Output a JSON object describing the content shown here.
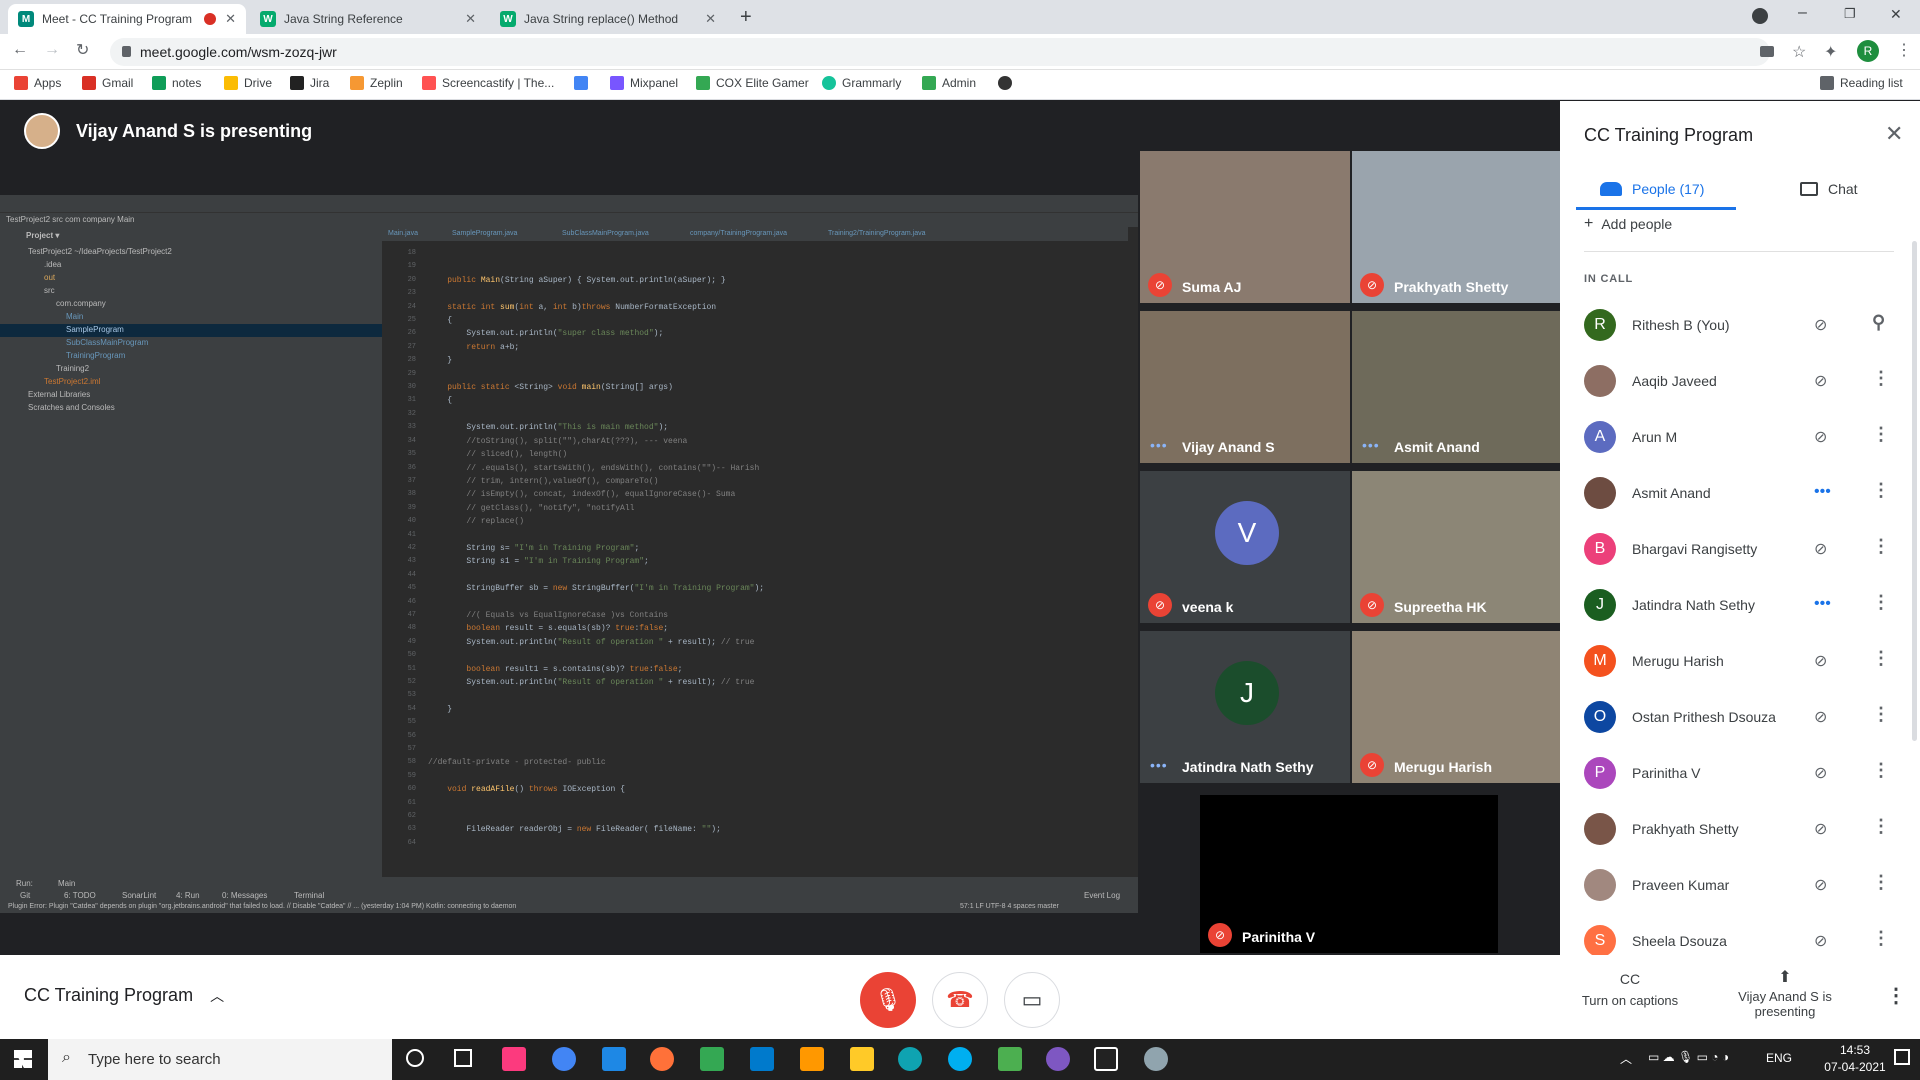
{
  "browser": {
    "tabs": [
      {
        "title": "Meet - CC Training Program",
        "active": true
      },
      {
        "title": "Java String Reference",
        "active": false
      },
      {
        "title": "Java String replace() Method",
        "active": false
      }
    ],
    "url": "meet.google.com/wsm-zozq-jwr",
    "bookmarks": [
      "Apps",
      "Gmail",
      "notes",
      "Drive",
      "Jira",
      "Zeplin",
      "Screencastify | The...",
      "Mixpanel",
      "COX Elite Gamer",
      "Grammarly",
      "Admin"
    ],
    "reading_list": "Reading list",
    "profile_initial": "R"
  },
  "meet": {
    "presenting_text": "Vijay Anand S is presenting",
    "meeting_name": "CC Training Program",
    "tiles": [
      {
        "name": "Suma AJ",
        "muted": true
      },
      {
        "name": "Prakhyath Shetty",
        "muted": true
      },
      {
        "name": "Vijay Anand S",
        "muted": false
      },
      {
        "name": "Asmit Anand",
        "muted": false
      },
      {
        "name": "veena k",
        "muted": true,
        "initial": "V"
      },
      {
        "name": "Supreetha HK",
        "muted": true
      },
      {
        "name": "Jatindra Nath Sethy",
        "muted": false,
        "initial": "J"
      },
      {
        "name": "Merugu Harish",
        "muted": true
      },
      {
        "name": "Parinitha V",
        "muted": true
      }
    ],
    "controls": {
      "captions": "Turn on captions",
      "presenting": "Vijay Anand S is presenting"
    }
  },
  "panel": {
    "title": "CC Training Program",
    "tab_people": "People (17)",
    "tab_chat": "Chat",
    "add_people": "Add people",
    "section": "IN CALL",
    "people": [
      {
        "name": "Rithesh B (You)",
        "initial": "R",
        "color": "#33691e",
        "state": "muted"
      },
      {
        "name": "Aaqib Javeed",
        "initial": "",
        "color": "#8d6e63",
        "state": "muted"
      },
      {
        "name": "Arun M",
        "initial": "A",
        "color": "#5c6bc0",
        "state": "muted"
      },
      {
        "name": "Asmit Anand",
        "initial": "",
        "color": "#6d4c41",
        "state": "talking"
      },
      {
        "name": "Bhargavi Rangisetty",
        "initial": "B",
        "color": "#ec407a",
        "state": "muted"
      },
      {
        "name": "Jatindra Nath Sethy",
        "initial": "J",
        "color": "#1b5e20",
        "state": "talking"
      },
      {
        "name": "Merugu Harish",
        "initial": "M",
        "color": "#f4511e",
        "state": "muted"
      },
      {
        "name": "Ostan Prithesh Dsouza",
        "initial": "O",
        "color": "#0d47a1",
        "state": "muted"
      },
      {
        "name": "Parinitha V",
        "initial": "P",
        "color": "#ab47bc",
        "state": "muted"
      },
      {
        "name": "Prakhyath Shetty",
        "initial": "",
        "color": "#795548",
        "state": "muted"
      },
      {
        "name": "Praveen Kumar",
        "initial": "",
        "color": "#a1887f",
        "state": "muted"
      },
      {
        "name": "Sheela Dsouza",
        "initial": "S",
        "color": "#ff7043",
        "state": "muted"
      }
    ]
  },
  "ide": {
    "breadcrumb": "TestProject2  src  com  company  Main",
    "editor_tabs": [
      "Main.java",
      "SampleProgram.java",
      "SubClassMainProgram.java",
      "company/TrainingProgram.java",
      "Training2/TrainingProgram.java"
    ],
    "tree": [
      "TestProject2 ~/IdeaProjects/TestProject2",
      ".idea",
      "out",
      "src",
      "com.company",
      "Main",
      "SampleProgram",
      "SubClassMainProgram",
      "TrainingProgram",
      "Training2",
      "TestProject2.iml",
      "External Libraries",
      "Scratches and Consoles"
    ],
    "status": "Plugin Error: Plugin \"Catdea\" depends on plugin \"org.jetbrains.android\" that failed to load. // Disable \"Catdea\" // ... (yesterday 1:04 PM)    Kotlin: connecting to daemon",
    "status_right": "57:1  LF  UTF-8  4 spaces  master",
    "bottom_tabs": [
      "Git",
      "6: TODO",
      "SonarLint",
      "4: Run",
      "0: Messages",
      "Terminal"
    ],
    "event_log": "Event Log",
    "run_label": "Run:",
    "run_config": "Main"
  },
  "taskbar": {
    "search_placeholder": "Type here to search",
    "time": "14:53",
    "date": "07-04-2021",
    "lang": "ENG"
  }
}
